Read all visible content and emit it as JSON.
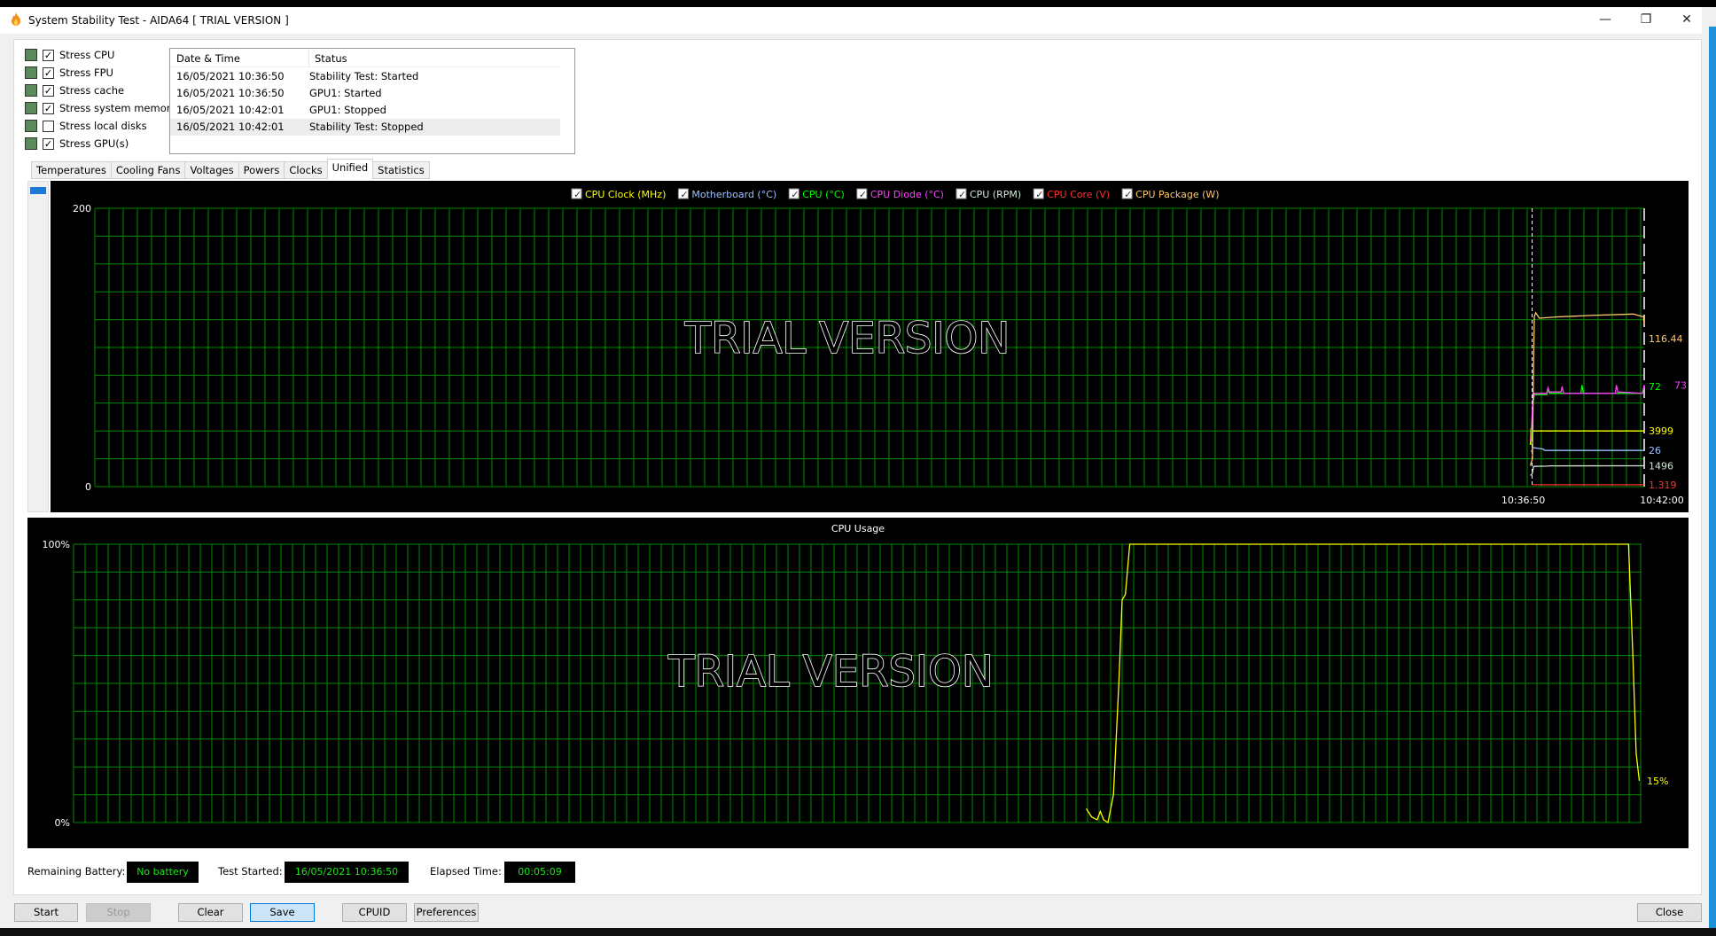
{
  "window": {
    "title": "System Stability Test - AIDA64  [ TRIAL VERSION ]",
    "minimize": "—",
    "maximize": "❐",
    "close": "✕"
  },
  "stress_options": [
    {
      "label": "Stress CPU",
      "checked": true,
      "icon": "cpu-chip-icon"
    },
    {
      "label": "Stress FPU",
      "checked": true,
      "icon": "fpu-chip-icon"
    },
    {
      "label": "Stress cache",
      "checked": true,
      "icon": "cache-chip-icon"
    },
    {
      "label": "Stress system memory",
      "checked": true,
      "icon": "memory-module-icon"
    },
    {
      "label": "Stress local disks",
      "checked": false,
      "icon": "disk-drive-icon"
    },
    {
      "label": "Stress GPU(s)",
      "checked": true,
      "icon": "gpu-monitor-icon"
    }
  ],
  "log": {
    "headers": [
      "Date & Time",
      "Status"
    ],
    "rows": [
      [
        "16/05/2021 10:36:50",
        "Stability Test: Started"
      ],
      [
        "16/05/2021 10:36:50",
        "GPU1: Started"
      ],
      [
        "16/05/2021 10:42:01",
        "GPU1: Stopped"
      ],
      [
        "16/05/2021 10:42:01",
        "Stability Test: Stopped"
      ]
    ]
  },
  "tabs": [
    "Temperatures",
    "Cooling Fans",
    "Voltages",
    "Powers",
    "Clocks",
    "Unified",
    "Statistics"
  ],
  "active_tab": "Unified",
  "watermark": "TRIAL VERSION",
  "chart_data": [
    {
      "type": "line",
      "title": "",
      "ylim": [
        0,
        200
      ],
      "yticks": [
        "200",
        "0"
      ],
      "xlim": [
        "09:30:35",
        "10:42:00"
      ],
      "xticks": [
        "10:36:50",
        "10:42:00"
      ],
      "grid": true,
      "legend_placement": "top",
      "series": [
        {
          "name": "CPU Clock (MHz)",
          "color": "#ffff00",
          "current": "3999",
          "points": [
            [
              "10:36:45",
              3000
            ],
            [
              "10:36:47",
              4200
            ],
            [
              "10:36:49",
              3300
            ],
            [
              "10:36:51",
              4000
            ],
            [
              "10:42:00",
              3999
            ]
          ]
        },
        {
          "name": "Motherboard (°C)",
          "color": "#9cc0ff",
          "current": "26",
          "points": [
            [
              "10:36:48",
              25
            ],
            [
              "10:36:52",
              28
            ],
            [
              "10:37:20",
              27
            ],
            [
              "10:37:25",
              26
            ],
            [
              "10:42:00",
              26
            ]
          ]
        },
        {
          "name": "CPU (°C)",
          "color": "#00ff00",
          "current": "72",
          "points": [
            [
              "10:36:47",
              30
            ],
            [
              "10:36:52",
              60
            ],
            [
              "10:36:56",
              66
            ],
            [
              "10:37:30",
              66
            ],
            [
              "10:37:34",
              70
            ],
            [
              "10:37:38",
              67
            ],
            [
              "10:39:05",
              67
            ],
            [
              "10:39:08",
              73
            ],
            [
              "10:39:12",
              67
            ],
            [
              "10:41:55",
              67
            ],
            [
              "10:42:00",
              72
            ]
          ]
        },
        {
          "name": "CPU Diode (°C)",
          "color": "#ff40ff",
          "current": "73",
          "points": [
            [
              "10:36:46",
              32
            ],
            [
              "10:36:52",
              62
            ],
            [
              "10:36:56",
              67
            ],
            [
              "10:37:30",
              67
            ],
            [
              "10:37:34",
              71
            ],
            [
              "10:37:38",
              68
            ],
            [
              "10:38:10",
              68
            ],
            [
              "10:38:13",
              72
            ],
            [
              "10:38:17",
              67
            ],
            [
              "10:40:40",
              67
            ],
            [
              "10:40:43",
              73
            ],
            [
              "10:40:47",
              68
            ],
            [
              "10:41:55",
              67
            ],
            [
              "10:42:00",
              73
            ]
          ]
        },
        {
          "name": "CPU (RPM)",
          "color": "#d0e8d8",
          "current": "1496",
          "points": [
            [
              "10:36:45",
              800
            ],
            [
              "10:36:50",
              900
            ],
            [
              "10:36:54",
              1450
            ],
            [
              "10:37:30",
              1470
            ],
            [
              "10:37:40",
              1490
            ],
            [
              "10:42:00",
              1496
            ]
          ]
        },
        {
          "name": "CPU Core (V)",
          "color": "#ff3030",
          "current": "1.319",
          "points": [
            [
              "10:36:50",
              1.319
            ],
            [
              "10:42:00",
              1.319
            ]
          ]
        },
        {
          "name": "CPU Package (W)",
          "color": "#ffc870",
          "current": "116.44",
          "points": [
            [
              "10:36:45",
              15
            ],
            [
              "10:36:51",
              20
            ],
            [
              "10:36:53",
              70
            ],
            [
              "10:36:56",
              122
            ],
            [
              "10:37:00",
              125
            ],
            [
              "10:37:10",
              121
            ],
            [
              "10:38:00",
              122
            ],
            [
              "10:39:30",
              123
            ],
            [
              "10:41:30",
              124
            ],
            [
              "10:41:58",
              122
            ],
            [
              "10:42:00",
              116.44
            ]
          ]
        }
      ]
    },
    {
      "type": "line",
      "title": "CPU Usage",
      "ylim": [
        0,
        100
      ],
      "yticks": [
        "100%",
        "0%"
      ],
      "grid": true,
      "color": "#ffff00",
      "current": "15%",
      "xlim": [
        0,
        144
      ],
      "points": [
        [
          93,
          5
        ],
        [
          93.5,
          2
        ],
        [
          94,
          1
        ],
        [
          94.3,
          4
        ],
        [
          94.6,
          1
        ],
        [
          95,
          0
        ],
        [
          95.5,
          10
        ],
        [
          96,
          50
        ],
        [
          96.3,
          80
        ],
        [
          96.6,
          82
        ],
        [
          97,
          100
        ],
        [
          142.8,
          100
        ],
        [
          143.2,
          60
        ],
        [
          143.5,
          25
        ],
        [
          143.8,
          15
        ]
      ]
    }
  ],
  "status": {
    "battery_label": "Remaining Battery:",
    "battery_value": "No battery",
    "started_label": "Test Started:",
    "started_value": "16/05/2021 10:36:50",
    "elapsed_label": "Elapsed Time:",
    "elapsed_value": "00:05:09"
  },
  "buttons": {
    "start": "Start",
    "stop": "Stop",
    "clear": "Clear",
    "save": "Save",
    "cpuid": "CPUID",
    "preferences": "Preferences",
    "close": "Close"
  }
}
